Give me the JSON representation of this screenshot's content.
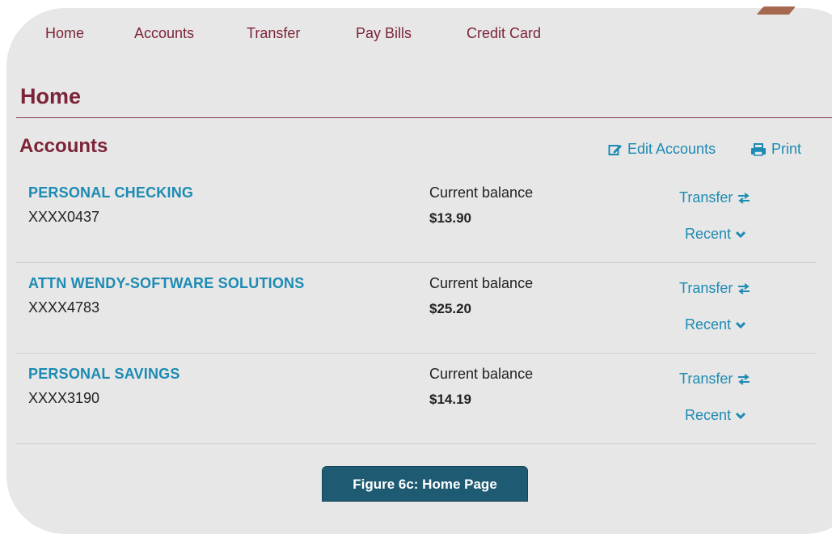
{
  "nav": {
    "items": [
      "Home",
      "Accounts",
      "Transfer",
      "Pay Bills",
      "Credit Card"
    ]
  },
  "page": {
    "title": "Home"
  },
  "accounts_section": {
    "title": "Accounts",
    "edit_label": "Edit Accounts",
    "print_label": "Print"
  },
  "accounts": [
    {
      "name": "PERSONAL CHECKING",
      "number": "XXXX0437",
      "balance_label": "Current balance",
      "balance": "$13.90",
      "transfer_label": "Transfer",
      "recent_label": "Recent"
    },
    {
      "name": "ATTN WENDY-SOFTWARE SOLUTIONS",
      "number": "XXXX4783",
      "balance_label": "Current balance",
      "balance": "$25.20",
      "transfer_label": "Transfer",
      "recent_label": "Recent"
    },
    {
      "name": "PERSONAL SAVINGS",
      "number": "XXXX3190",
      "balance_label": "Current balance",
      "balance": "$14.19",
      "transfer_label": "Transfer",
      "recent_label": "Recent"
    }
  ],
  "caption": "Figure 6c: Home Page",
  "colors": {
    "brand": "#7b2437",
    "link": "#1c8bb3",
    "caption_bg": "#1e5b73"
  },
  "icons": {
    "edit": "edit-icon",
    "print": "printer-icon",
    "transfer": "transfer-arrows-icon",
    "recent": "chevron-down-icon"
  }
}
